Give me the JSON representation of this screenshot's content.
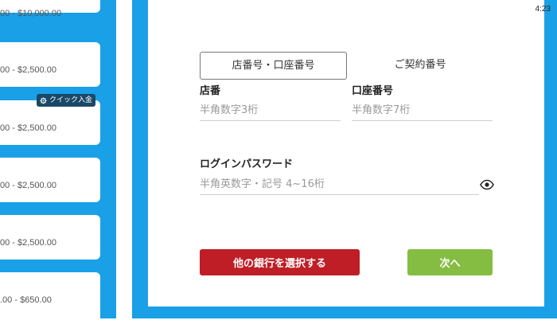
{
  "left_cards": [
    {
      "range": "00 - $10,000.00"
    },
    {
      "range": "00 - $2,500.00"
    },
    {
      "range": "00 - $2,500.00"
    },
    {
      "range": "00 - $2,500.00"
    },
    {
      "range": "00 - $2,500.00"
    },
    {
      "range": ".00 - $650.00"
    }
  ],
  "quick_badge": {
    "label": "クイック入金",
    "icon": "gear-icon"
  },
  "status": {
    "time": "4:23"
  },
  "tabs": [
    {
      "label": "店番号・口座番号",
      "active": true
    },
    {
      "label": "ご契約番号",
      "active": false
    }
  ],
  "form": {
    "branch": {
      "label": "店番",
      "placeholder": "半角数字3桁",
      "value": ""
    },
    "account": {
      "label": "口座番号",
      "placeholder": "半角数字7桁",
      "value": ""
    },
    "password": {
      "label": "ログインパスワード",
      "placeholder": "半角英数字・記号 4~16桁",
      "value": "",
      "icon": "eye-icon"
    }
  },
  "buttons": {
    "other_bank": "他の銀行を選択する",
    "next": "次へ"
  },
  "colors": {
    "frame_blue": "#1aa0e6",
    "badge_navy": "#1a4868",
    "other_bank_red": "#bf1e26",
    "next_green": "#85bd42"
  }
}
